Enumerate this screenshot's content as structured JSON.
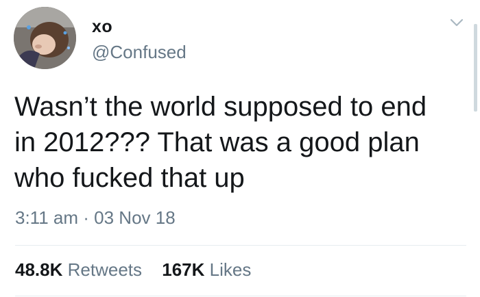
{
  "tweet": {
    "display_name": "xo",
    "handle": "@Confused",
    "text_lines": [
      "Wasn’t the world supposed to end",
      "in 2012??? That was a good plan",
      "who fucked that up"
    ],
    "time": "3:11 am",
    "separator": "·",
    "date": "03 Nov 18"
  },
  "stats": {
    "retweets_count": "48.8K",
    "retweets_label": "Retweets",
    "likes_count": "167K",
    "likes_label": "Likes"
  },
  "icons": {
    "menu": "chevron-down-icon",
    "avatar": "profile-photo"
  },
  "colors": {
    "text": "#14171a",
    "secondary": "#657786",
    "divider": "#e6ecf0"
  }
}
